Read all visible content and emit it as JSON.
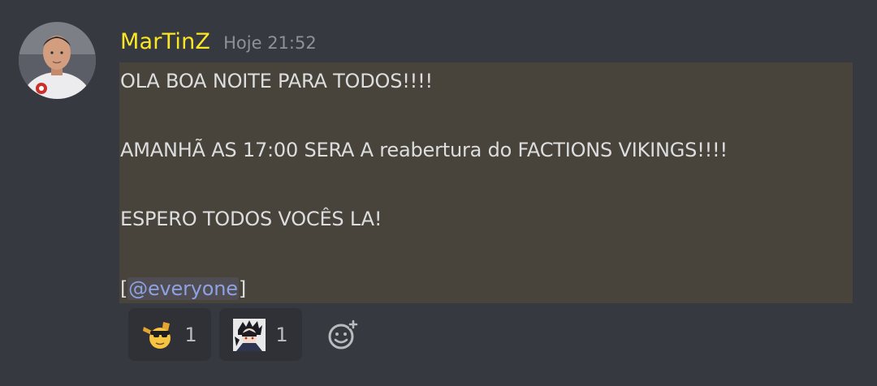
{
  "message": {
    "author": "MarTinZ",
    "author_color": "#fae624",
    "timestamp": "Hoje 21:52",
    "lines": [
      "OLA BOA NOITE PARA TODOS!!!!",
      "AMANHÃ AS 17:00 SERA A reabertura do FACTIONS VIKINGS!!!!",
      "ESPERO TODOS VOCÊS LA!"
    ],
    "mention_open": "[",
    "mention": "@everyone",
    "mention_close": "]",
    "highlight_color": "#49443b"
  },
  "reactions": [
    {
      "emoji": "cool-dab-emoji",
      "count": "1"
    },
    {
      "emoji": "anime-character-emoji",
      "count": "1"
    }
  ],
  "add_reaction": {
    "icon": "add-reaction-icon"
  }
}
